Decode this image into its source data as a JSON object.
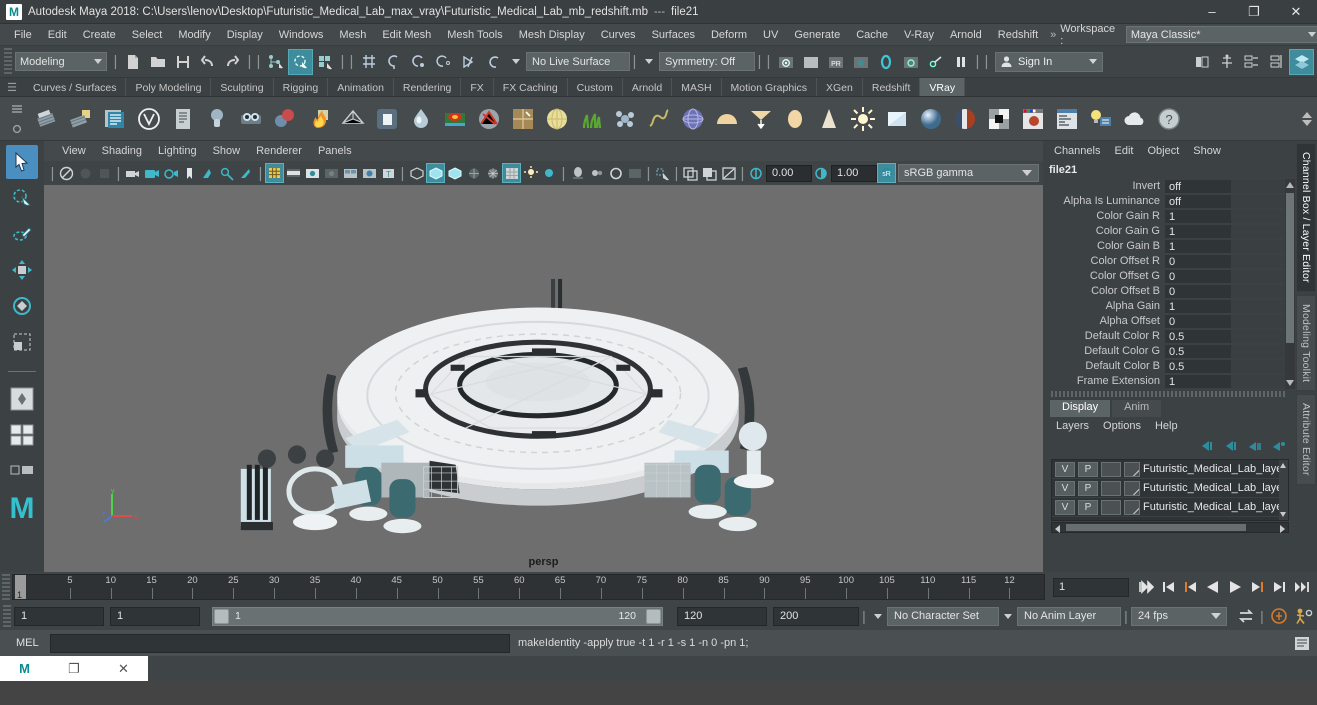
{
  "titlebar": {
    "app_icon": "maya-logo",
    "title": "Autodesk Maya 2018: C:\\Users\\lenov\\Desktop\\Futuristic_Medical_Lab_max_vray\\Futuristic_Medical_Lab_mb_redshift.mb",
    "separator": "---",
    "object": "file21",
    "minimize": "–",
    "restore": "❐",
    "close": "✕"
  },
  "menubar": {
    "items": [
      "File",
      "Edit",
      "Create",
      "Select",
      "Modify",
      "Display",
      "Windows",
      "Mesh",
      "Edit Mesh",
      "Mesh Tools",
      "Mesh Display",
      "Curves",
      "Surfaces",
      "Deform",
      "UV",
      "Generate",
      "Cache",
      "V-Ray",
      "Arnold",
      "Redshift"
    ],
    "overflow": "»",
    "workspace_label": "Workspace :",
    "workspace_value": "Maya Classic*",
    "lock_icon": "lock-icon"
  },
  "statusbar": {
    "menuset": "Modeling",
    "file_icons": [
      "new-scene-icon",
      "open-scene-icon",
      "save-scene-icon",
      "undo-icon",
      "redo-icon"
    ],
    "select_icons": [
      "select-hierarchy-icon",
      "select-object-icon",
      "select-component-icon"
    ],
    "snap_icons": [
      "snap-grid-icon",
      "snap-curve-icon",
      "snap-point-icon",
      "snap-projected-center-icon",
      "snap-view-plane-icon",
      "make-live-icon"
    ],
    "live_surface": "No Live Surface",
    "symmetry": "Symmetry: Off",
    "render_icons": [
      "render-current-frame-icon",
      "ipr-render-icon",
      "render-settings-icon",
      "hypershade-icon",
      "render-view-icon",
      "render-sequence-icon",
      "pause-icon"
    ],
    "signin": "Sign In",
    "signin_icon": "user-icon",
    "right_icons": [
      "sidebar-toggle-icon",
      "attribute-editor-icon",
      "tool-settings-icon",
      "channel-box-icon",
      "show-hide-icon"
    ]
  },
  "shelf": {
    "tabs": [
      "Curves / Surfaces",
      "Poly Modeling",
      "Sculpting",
      "Rigging",
      "Animation",
      "Rendering",
      "FX",
      "FX Caching",
      "Custom",
      "Arnold",
      "MASH",
      "Motion Graphics",
      "XGen",
      "Redshift",
      "VRay"
    ],
    "selected_tab": "VRay",
    "icons": [
      {
        "name": "vray-render-icon",
        "glyph": "▒"
      },
      {
        "name": "vray-render-folder-icon",
        "glyph": "▒"
      },
      {
        "name": "vray-frame-buffer-icon",
        "glyph": "☰"
      },
      {
        "name": "vray-logo-icon",
        "glyph": "Ⓥ"
      },
      {
        "name": "vray-render-settings-icon",
        "glyph": "☷"
      },
      {
        "name": "vray-light-dome-icon",
        "glyph": "●"
      },
      {
        "name": "vray-camera-icon",
        "glyph": "◉"
      },
      {
        "name": "vray-sphere-fade-icon",
        "glyph": "●"
      },
      {
        "name": "vray-fire-icon",
        "glyph": "♨"
      },
      {
        "name": "vray-plane-icon",
        "glyph": "△"
      },
      {
        "name": "vray-proxy-icon",
        "glyph": "■"
      },
      {
        "name": "vray-water-drop-icon",
        "glyph": "●"
      },
      {
        "name": "vray-displacement-icon",
        "glyph": "▰"
      },
      {
        "name": "vray-fur-icon",
        "glyph": "✇"
      },
      {
        "name": "vray-uv-icon",
        "glyph": "⊞"
      },
      {
        "name": "vray-sphere-light-icon",
        "glyph": "●"
      },
      {
        "name": "vray-grass-icon",
        "glyph": "❦"
      },
      {
        "name": "vray-particle-icon",
        "glyph": "❆"
      },
      {
        "name": "vray-curve-icon",
        "glyph": "∿"
      },
      {
        "name": "vray-dome-light-icon",
        "glyph": "●"
      },
      {
        "name": "vray-light-hemi-icon",
        "glyph": "◖"
      },
      {
        "name": "vray-light-ies-icon",
        "glyph": "▽"
      },
      {
        "name": "vray-light-sphere-icon",
        "glyph": "●"
      },
      {
        "name": "vray-light-spot-icon",
        "glyph": "△"
      },
      {
        "name": "vray-sun-icon",
        "glyph": "☀"
      },
      {
        "name": "vray-light-rect-icon",
        "glyph": "▭"
      },
      {
        "name": "vray-material-sphere-icon",
        "glyph": "●"
      },
      {
        "name": "vray-material-blend-icon",
        "glyph": "◑"
      },
      {
        "name": "vray-checker-icon",
        "glyph": "▦"
      },
      {
        "name": "vray-material-preview-icon",
        "glyph": "▣"
      },
      {
        "name": "vray-attributes-icon",
        "glyph": "≡"
      },
      {
        "name": "vray-light-lister-icon",
        "glyph": "Ὂ1"
      },
      {
        "name": "vray-cloud-icon",
        "glyph": "☁"
      },
      {
        "name": "vray-help-icon",
        "glyph": "?"
      }
    ]
  },
  "toolbox": {
    "tools": [
      {
        "name": "select-tool",
        "glyph": "➤",
        "selected": true
      },
      {
        "name": "lasso-select-tool",
        "glyph": "➤"
      },
      {
        "name": "paint-select-tool",
        "glyph": "✒"
      },
      {
        "name": "move-tool",
        "glyph": "✣"
      },
      {
        "name": "rotate-tool",
        "glyph": "↻"
      },
      {
        "name": "scale-tool",
        "glyph": "⬚"
      }
    ],
    "layout_buttons": [
      {
        "name": "single-perspective-layout-icon"
      },
      {
        "name": "four-view-layout-icon"
      },
      {
        "name": "two-pane-layout-icon"
      }
    ],
    "maya-logo": "M"
  },
  "viewport": {
    "menus": [
      "View",
      "Shading",
      "Lighting",
      "Show",
      "Renderer",
      "Panels"
    ],
    "camera_label": "persp",
    "exposure": "0.00",
    "gamma": "1.00",
    "color_profile": "sRGB gamma",
    "toolbar_icons": [
      "select-camera-icon",
      "bookmark-icon",
      "camera-attributes-icon",
      "image-plane-icon",
      "two-sided-lighting-icon",
      "shadows-icon",
      "screen-space-ao-icon",
      "multisample-icon",
      "grid-toggle-icon",
      "film-gate-icon",
      "resolution-gate-icon",
      "gate-mask-icon",
      "xray-icon",
      "xray-joints-icon",
      "texture-icon",
      "wireframe-icon",
      "smooth-shade-icon",
      "smooth-shade-all-icon",
      "flat-shade-icon",
      "wireframe-on-shaded-icon",
      "texture-mode-icon",
      "use-default-lighting-icon",
      "shadow-map-icon",
      "ambient-occlusion-icon",
      "motion-blur-icon",
      "isolate-select-icon",
      "xray-mode-icon",
      "exposure-icon",
      "gamma-icon",
      "view-transform-icon"
    ]
  },
  "channelbox": {
    "menus": [
      "Channels",
      "Edit",
      "Object",
      "Show"
    ],
    "node_name": "file21",
    "attributes": [
      {
        "label": "Invert",
        "value": "off"
      },
      {
        "label": "Alpha Is Luminance",
        "value": "off"
      },
      {
        "label": "Color Gain R",
        "value": "1"
      },
      {
        "label": "Color Gain G",
        "value": "1"
      },
      {
        "label": "Color Gain B",
        "value": "1"
      },
      {
        "label": "Color Offset R",
        "value": "0"
      },
      {
        "label": "Color Offset G",
        "value": "0"
      },
      {
        "label": "Color Offset B",
        "value": "0"
      },
      {
        "label": "Alpha Gain",
        "value": "1"
      },
      {
        "label": "Alpha Offset",
        "value": "0"
      },
      {
        "label": "Default Color R",
        "value": "0.5"
      },
      {
        "label": "Default Color G",
        "value": "0.5"
      },
      {
        "label": "Default Color B",
        "value": "0.5"
      },
      {
        "label": "Frame Extension",
        "value": "1"
      }
    ]
  },
  "layereditor": {
    "tabs": [
      "Display",
      "Anim"
    ],
    "selected_tab": "Display",
    "menus": [
      "Layers",
      "Options",
      "Help"
    ],
    "buttons": [
      "move-layer-up-icon",
      "move-layer-down-icon",
      "new-layer-icon",
      "new-layer-from-selected-icon"
    ],
    "layers": [
      {
        "visibility": "V",
        "playback": "P",
        "shading": "",
        "name": "Futuristic_Medical_Lab_layer"
      },
      {
        "visibility": "V",
        "playback": "P",
        "shading": "",
        "name": "Futuristic_Medical_Lab_layer"
      },
      {
        "visibility": "V",
        "playback": "P",
        "shading": "",
        "name": "Futuristic_Medical_Lab_layer"
      }
    ]
  },
  "right_tabs": {
    "items": [
      "Channel Box / Layer Editor",
      "Modeling Toolkit",
      "Attribute Editor"
    ],
    "selected": "Channel Box / Layer Editor"
  },
  "timeline": {
    "current_frame": "1",
    "tick_labels": [
      "5",
      "10",
      "15",
      "20",
      "25",
      "30",
      "35",
      "40",
      "45",
      "50",
      "55",
      "60",
      "65",
      "70",
      "75",
      "80",
      "85",
      "90",
      "95",
      "100",
      "105",
      "110",
      "115",
      "12"
    ],
    "playback_buttons": [
      {
        "name": "go-to-start-button",
        "glyph": "⏮"
      },
      {
        "name": "step-back-keyframe-button",
        "glyph": "⏴"
      },
      {
        "name": "step-back-frame-button",
        "glyph": "⏴"
      },
      {
        "name": "play-backwards-button",
        "glyph": "◀"
      },
      {
        "name": "play-forwards-button",
        "glyph": "▶"
      },
      {
        "name": "step-forward-frame-button",
        "glyph": "⏵"
      },
      {
        "name": "step-forward-keyframe-button",
        "glyph": "⏵"
      },
      {
        "name": "go-to-end-button",
        "glyph": "⏭"
      }
    ]
  },
  "rangeslider": {
    "anim_start": "1",
    "range_start": "1",
    "bar_left_value": "1",
    "bar_right_value": "120",
    "range_end": "120",
    "anim_end": "200",
    "character_set": "No Character Set",
    "anim_layer": "No Anim Layer",
    "fps": "24 fps",
    "icons": [
      "loop-playback-icon",
      "auto-key-icon",
      "animation-preferences-icon"
    ]
  },
  "commandline": {
    "mel_label": "MEL",
    "input_value": "",
    "output": "makeIdentity -apply true -t 1 -r 1 -s 1 -n 0 -pn 1;",
    "script_editor_icon": "script-editor-icon"
  },
  "taskbar": {
    "items": [
      {
        "name": "maya-taskbar-icon",
        "glyph": "M"
      },
      {
        "name": "window-taskbar-icon",
        "glyph": "❐"
      },
      {
        "name": "close-taskbar-icon",
        "glyph": "✕"
      }
    ]
  },
  "colors": {
    "accent_teal": "#3f8c9c",
    "select_blue": "#4a8fc0",
    "panel_bg": "#3c4244",
    "viewport_bg": "#6e6e6e",
    "field_bg": "#2f3436"
  }
}
